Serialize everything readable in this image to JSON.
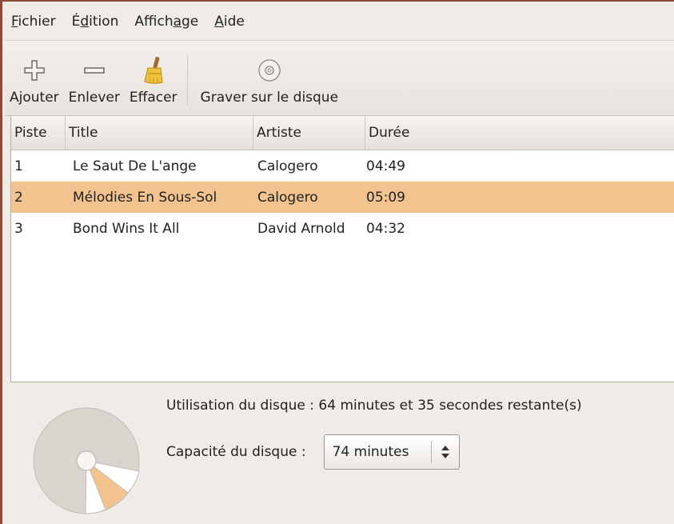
{
  "menubar": {
    "items": [
      {
        "pre": "",
        "ul": "F",
        "post": "ichier"
      },
      {
        "pre": "É",
        "ul": "d",
        "post": "ition"
      },
      {
        "pre": "Affich",
        "ul": "a",
        "post": "ge"
      },
      {
        "pre": "",
        "ul": "A",
        "post": "ide"
      }
    ]
  },
  "toolbar": {
    "add_label": "Ajouter",
    "remove_label": "Enlever",
    "clear_label": "Effacer",
    "burn_label": "Graver sur le disque"
  },
  "table": {
    "columns": [
      "Piste",
      "Title",
      "Artiste",
      "Durée"
    ],
    "rows": [
      {
        "track": "1",
        "title": "Le Saut De L'ange",
        "artist": "Calogero",
        "duration": "04:49"
      },
      {
        "track": "2",
        "title": "Mélodies En Sous-Sol",
        "artist": "Calogero",
        "duration": "05:09"
      },
      {
        "track": "3",
        "title": "Bond Wins It All",
        "artist": "David Arnold",
        "duration": "04:32"
      }
    ],
    "selected_row": 1
  },
  "status": {
    "usage_text": "Utilisation du disque : 64 minutes et 35 secondes restante(s)",
    "capacity_label": "Capacité du disque :",
    "capacity_value": "74 minutes"
  },
  "colors": {
    "selection": "#f2c38f",
    "disc_free": "#dad4ce",
    "disc_used": "#ffffff",
    "disc_selected": "#f2c38f"
  },
  "icons": {
    "add": "plus-icon",
    "remove": "minus-icon",
    "clear": "broom-icon",
    "burn": "cd-icon",
    "combo": "spin-arrows-icon"
  }
}
